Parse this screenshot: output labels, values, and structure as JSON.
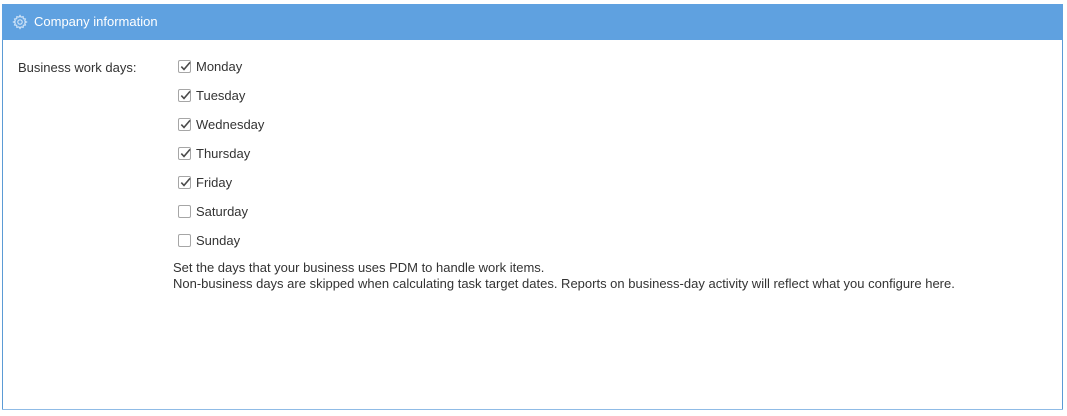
{
  "header": {
    "icon": "gear-icon",
    "title": "Company information",
    "color": "#5fa1e0"
  },
  "form": {
    "business_days_label": "Business work days:",
    "days": [
      {
        "label": "Monday",
        "checked": true
      },
      {
        "label": "Tuesday",
        "checked": true
      },
      {
        "label": "Wednesday",
        "checked": true
      },
      {
        "label": "Thursday",
        "checked": true
      },
      {
        "label": "Friday",
        "checked": true
      },
      {
        "label": "Saturday",
        "checked": false
      },
      {
        "label": "Sunday",
        "checked": false
      }
    ],
    "help_line1": "Set the days that your business uses PDM to handle work items.",
    "help_line2": "Non-business days are skipped when calculating task target dates. Reports on business-day activity will reflect what you configure here."
  }
}
